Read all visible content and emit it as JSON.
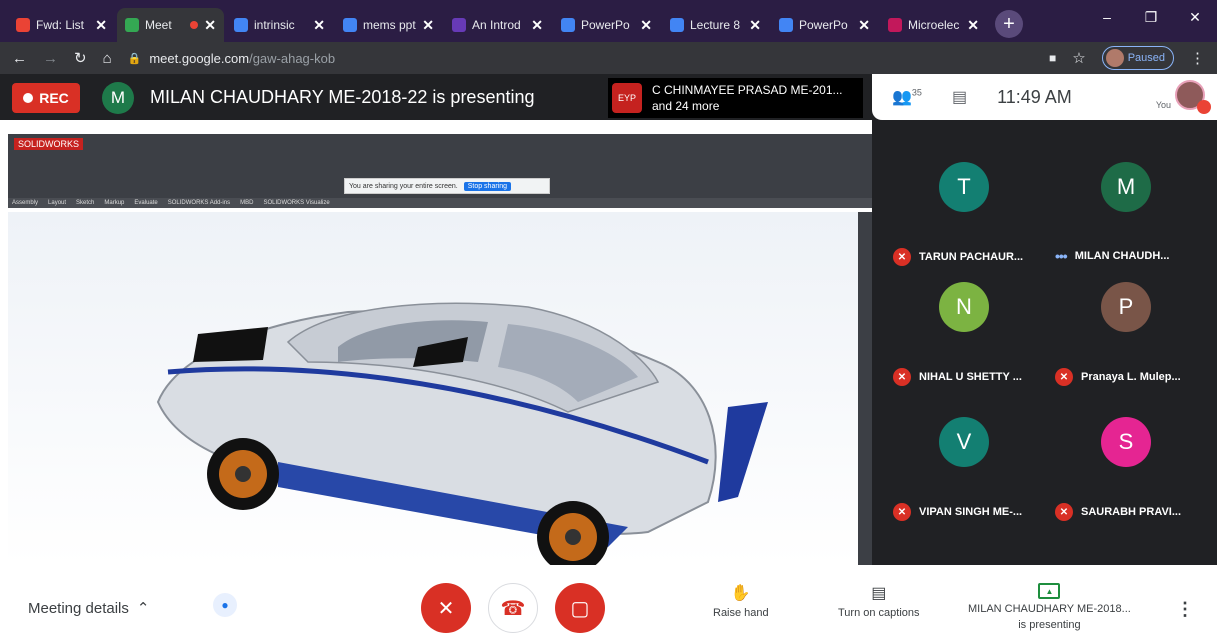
{
  "browser": {
    "tabs": [
      {
        "label": "Fwd: List",
        "color": "#ea4335"
      },
      {
        "label": "Meet",
        "color": "#34a853",
        "active": true
      },
      {
        "label": "intrinsic",
        "color": "#4285f4"
      },
      {
        "label": "mems ppt",
        "color": "#4285f4"
      },
      {
        "label": "An Introd",
        "color": "#673ab7"
      },
      {
        "label": "PowerPo",
        "color": "#4285f4"
      },
      {
        "label": "Lecture 8",
        "color": "#4285f4"
      },
      {
        "label": "PowerPo",
        "color": "#4285f4"
      },
      {
        "label": "Microelec",
        "color": "#c2185b"
      }
    ],
    "url_host": "meet.google.com",
    "url_path": "/gaw-ahag-kob",
    "profile_label": "Paused"
  },
  "meet": {
    "rec_label": "REC",
    "presenter_initial": "M",
    "presenting_text": "MILAN CHAUDHARY ME-2018-22 is presenting",
    "join_notice": {
      "avatar_text": "EYP",
      "line1": "C CHINMAYEE PRASAD ME-201...",
      "line2": "and 24 more"
    },
    "participants_count": "35",
    "clock": "11:49 AM",
    "you_label": "You"
  },
  "cad": {
    "app_label": "SOLIDWORKS",
    "tabs": [
      "Assembly",
      "Layout",
      "Sketch",
      "Markup",
      "Evaluate",
      "SOLIDWORKS Add-ins",
      "MBD",
      "SOLIDWORKS Visualize"
    ],
    "share_notice": "You are sharing your entire screen.",
    "share_stop": "Stop sharing"
  },
  "participants": [
    {
      "initial": "T",
      "name": "TARUN PACHAUR...",
      "color": "#137f72",
      "muted": true
    },
    {
      "initial": "M",
      "name": "MILAN CHAUDH...",
      "color": "#1e6b47",
      "muted": false
    },
    {
      "initial": "N",
      "name": "NIHAL U SHETTY ...",
      "color": "#7cb342",
      "muted": true
    },
    {
      "initial": "P",
      "name": "Pranaya L. Mulep...",
      "color": "#795548",
      "muted": true
    },
    {
      "initial": "V",
      "name": "VIPAN SINGH ME-...",
      "color": "#137f72",
      "muted": true
    },
    {
      "initial": "S",
      "name": "SAURABH PRAVI...",
      "color": "#e52592",
      "muted": true
    }
  ],
  "bottom": {
    "meeting_details": "Meeting details",
    "raise_hand": "Raise hand",
    "captions": "Turn on captions",
    "presenting_line1": "MILAN CHAUDHARY ME-2018...",
    "presenting_line2": "is presenting"
  }
}
